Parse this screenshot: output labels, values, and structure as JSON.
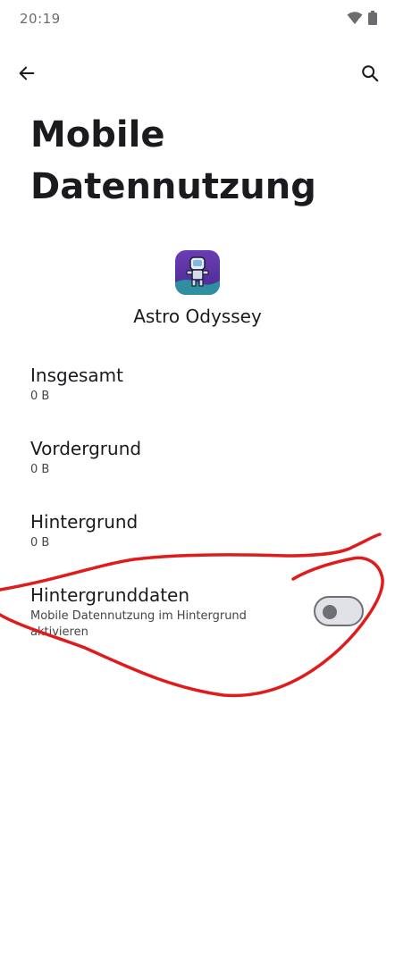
{
  "status_bar": {
    "time": "20:19",
    "icons": [
      "wifi-icon",
      "battery-icon"
    ]
  },
  "toolbar": {
    "back_icon": "arrow-back-icon",
    "search_icon": "search-icon"
  },
  "page": {
    "title": "Mobile Datennutzung"
  },
  "app": {
    "name": "Astro Odyssey",
    "icon": "astro-odyssey-app-icon"
  },
  "preferences": [
    {
      "title": "Insgesamt",
      "summary": "0 B"
    },
    {
      "title": "Vordergrund",
      "summary": "0 B"
    },
    {
      "title": "Hintergrund",
      "summary": "0 B"
    },
    {
      "title": "Hintergrunddaten",
      "summary": "Mobile Datennutzung im Hintergrund aktivieren",
      "toggle_on": false
    }
  ],
  "colors": {
    "annotation_stroke": "#e01b1b",
    "app_icon_bg": "#5a34a3",
    "toggle_outline": "#6f6f74"
  }
}
